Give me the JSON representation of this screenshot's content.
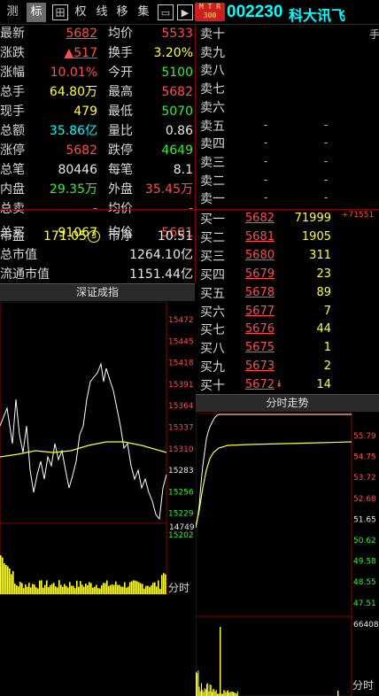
{
  "toolbar": {
    "buttons": [
      {
        "label": "测",
        "active": false
      },
      {
        "label": "标",
        "active": true
      },
      {
        "label": "田",
        "active": false
      },
      {
        "label": "权",
        "active": false
      },
      {
        "label": "线",
        "active": false
      },
      {
        "label": "移",
        "active": false
      },
      {
        "label": "集",
        "active": false
      },
      {
        "label": "▭",
        "active": false
      },
      {
        "label": "▶",
        "active": false
      }
    ],
    "badge_top": "M T R",
    "badge_bottom": "300",
    "code": "002230",
    "name": "科大讯飞",
    "hand_tag": "手"
  },
  "quote": {
    "rows": [
      {
        "l1": "最新",
        "v1": "5682",
        "c1": "red",
        "u1": true,
        "l2": "均价",
        "v2": "5533",
        "c2": "red"
      },
      {
        "l1": "涨跌",
        "v1": "▲517",
        "c1": "red",
        "u1": true,
        "l2": "换手",
        "v2": "3.20%",
        "c2": "yellow"
      },
      {
        "l1": "涨幅",
        "v1": "10.01%",
        "c1": "red",
        "u1": false,
        "l2": "今开",
        "v2": "5100",
        "c2": "green"
      },
      {
        "l1": "总手",
        "v1": "64.80万",
        "c1": "yellow",
        "u1": false,
        "l2": "最高",
        "v2": "5682",
        "c2": "red"
      },
      {
        "l1": "现手",
        "v1": "479",
        "c1": "yellow",
        "u1": false,
        "l2": "最低",
        "v2": "5070",
        "c2": "green"
      },
      {
        "l1": "总额",
        "v1": "35.86亿",
        "c1": "cyan",
        "u1": false,
        "l2": "量比",
        "v2": "0.86",
        "c2": "white"
      },
      {
        "l1": "涨停",
        "v1": "5682",
        "c1": "red",
        "u1": false,
        "l2": "跌停",
        "v2": "4649",
        "c2": "green"
      },
      {
        "l1": "总笔",
        "v1": "80446",
        "c1": "white",
        "u1": false,
        "l2": "每笔",
        "v2": "8.1",
        "c2": "white"
      },
      {
        "l1": "内盘",
        "v1": "29.35万",
        "c1": "green",
        "u1": false,
        "l2": "外盘",
        "v2": "35.45万",
        "c2": "red"
      },
      {
        "l1": "总卖",
        "v1": "-",
        "c1": "white",
        "u1": false,
        "l2": "均价",
        "v2": "-",
        "c2": "white"
      },
      {
        "l1": "总买",
        "v1": "91067",
        "c1": "yellow",
        "u1": false,
        "l2": "均价",
        "v2": "5601",
        "c2": "red"
      }
    ],
    "pe_label": "市盈",
    "pe_value": "171.05",
    "pe_badge": "3",
    "pb_label": "市净",
    "pb_value": "10.51",
    "mktcap_label": "总市值",
    "mktcap_value": "1264.10亿",
    "float_label": "流通市值",
    "float_value": "1151.44亿"
  },
  "orderbook": {
    "asks": [
      {
        "label": "卖十",
        "price": "",
        "vol": ""
      },
      {
        "label": "卖九",
        "price": "",
        "vol": ""
      },
      {
        "label": "卖八",
        "price": "",
        "vol": ""
      },
      {
        "label": "卖七",
        "price": "",
        "vol": ""
      },
      {
        "label": "卖六",
        "price": "",
        "vol": ""
      },
      {
        "label": "卖五",
        "price": "-",
        "vol": "-"
      },
      {
        "label": "卖四",
        "price": "-",
        "vol": "-"
      },
      {
        "label": "卖三",
        "price": "-",
        "vol": "-"
      },
      {
        "label": "卖二",
        "price": "-",
        "vol": "-"
      },
      {
        "label": "卖一",
        "price": "-",
        "vol": "-"
      }
    ],
    "bids": [
      {
        "label": "买一",
        "price": "5682",
        "vol": "71999"
      },
      {
        "label": "买二",
        "price": "5681",
        "vol": "1905"
      },
      {
        "label": "买三",
        "price": "5680",
        "vol": "311"
      },
      {
        "label": "买四",
        "price": "5679",
        "vol": "23"
      },
      {
        "label": "买五",
        "price": "5678",
        "vol": "89"
      },
      {
        "label": "买六",
        "price": "5677",
        "vol": "7"
      },
      {
        "label": "买七",
        "price": "5676",
        "vol": "44"
      },
      {
        "label": "买八",
        "price": "5675",
        "vol": "1"
      },
      {
        "label": "买九",
        "price": "5673",
        "vol": "2"
      },
      {
        "label": "买十",
        "price": "5672",
        "vol": "14"
      }
    ],
    "buy_delta": "+71551"
  },
  "index_chart": {
    "title": "深证成指",
    "y_labels": [
      "15472",
      "15445",
      "15418",
      "15391",
      "15364",
      "15337",
      "15310",
      "15283",
      "15256",
      "15229",
      "15202"
    ],
    "vol_label": "14749",
    "footer": "分时"
  },
  "stock_chart": {
    "title": "分时走势",
    "y_labels": [
      "55.79",
      "54.75",
      "53.72",
      "52.68",
      "51.65",
      "50.62",
      "49.58",
      "48.55",
      "47.51"
    ],
    "vol_label": "66408",
    "footer": "分时"
  },
  "colors": {
    "up": "#ff4c4c",
    "down": "#33ee33",
    "grid": "#8a0000",
    "price_line": "#ffffff",
    "avg_line": "#ffff33",
    "volume": "#ffff33"
  }
}
